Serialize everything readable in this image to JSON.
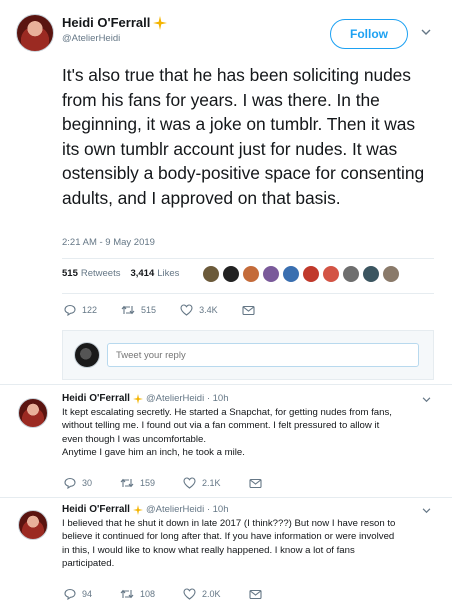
{
  "tweet": {
    "author_name": "Heidi O'Ferrall",
    "author_handle": "@AtelierHeidi",
    "follow_label": "Follow",
    "text": "It's also true that he has been soliciting nudes from his fans for years. I was there. In the beginning, it was a joke on tumblr. Then it was its own tumblr account just for nudes. It was ostensibly a body-positive space for consenting adults, and I approved on that basis.",
    "timestamp": "2:21 AM - 9 May 2019",
    "retweets_count": "515",
    "retweets_label": "Retweets",
    "likes_count": "3,414",
    "likes_label": "Likes",
    "actions": {
      "replies": "122",
      "retweets": "515",
      "likes": "3.4K"
    }
  },
  "reply_box": {
    "placeholder": "Tweet your reply"
  },
  "replies": [
    {
      "name": "Heidi O'Ferrall",
      "handle_time": "@AtelierHeidi · 10h",
      "text_lines": [
        "It kept escalating secretly. He started a Snapchat, for getting nudes from fans,",
        "without telling me. I found out via a fan comment. I felt pressured to allow it",
        "even though I was uncomfortable.",
        "Anytime I gave him an inch, he took a mile."
      ],
      "actions": {
        "replies": "30",
        "retweets": "159",
        "likes": "2.1K"
      }
    },
    {
      "name": "Heidi O'Ferrall",
      "handle_time": "@AtelierHeidi · 10h",
      "text_lines": [
        "I believed that he shut it down in late 2017 (I think???) But now I have reson to",
        "believe it continued for long after that. If you have information or were involved",
        "in this, I would like to know what really happened. I know a lot of fans",
        "participated."
      ],
      "actions": {
        "replies": "94",
        "retweets": "108",
        "likes": "2.0K"
      }
    }
  ],
  "icons": {
    "sparkle": "sparkles-icon",
    "caret": "chevron-down-icon",
    "reply": "reply-icon",
    "retweet": "retweet-icon",
    "like": "heart-icon",
    "dm": "envelope-icon"
  },
  "colors": {
    "accent": "#1da1f2",
    "muted": "#657786",
    "sparkle": "#f4b400",
    "divider": "#e6ecf0"
  }
}
